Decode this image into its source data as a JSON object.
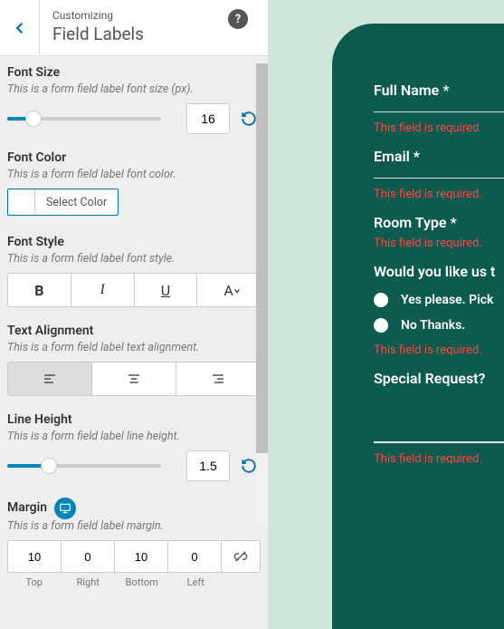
{
  "header": {
    "breadcrumb": "Customizing",
    "title": "Field Labels",
    "help": "?"
  },
  "sections": {
    "fontSize": {
      "label": "Font Size",
      "desc": "This is a form field label font size (px).",
      "value": "16",
      "fillPct": 17
    },
    "fontColor": {
      "label": "Font Color",
      "desc": "This is a form field label font color.",
      "selectLabel": "Select Color"
    },
    "fontStyle": {
      "label": "Font Style",
      "desc": "This is a form field label font style.",
      "bold": "B",
      "italic": "I",
      "underline": "U",
      "lower": "A"
    },
    "textAlign": {
      "label": "Text Alignment",
      "desc": "This is a form field label text alignment."
    },
    "lineHeight": {
      "label": "Line Height",
      "desc": "This is a form field label line height.",
      "value": "1.5",
      "fillPct": 27
    },
    "margin": {
      "label": "Margin",
      "desc": "This is a form field label margin.",
      "top": "10",
      "right": "0",
      "bottom": "10",
      "left": "0",
      "labels": {
        "top": "Top",
        "right": "Right",
        "bottom": "Bottom",
        "left": "Left"
      }
    }
  },
  "preview": {
    "fullName": "Full Name *",
    "email": "Email *",
    "roomType": "Room Type *",
    "question": "Would you like us t",
    "opt1": "Yes please. Pick",
    "opt2": "No Thanks.",
    "special": "Special Request?",
    "error": "This field is required."
  }
}
